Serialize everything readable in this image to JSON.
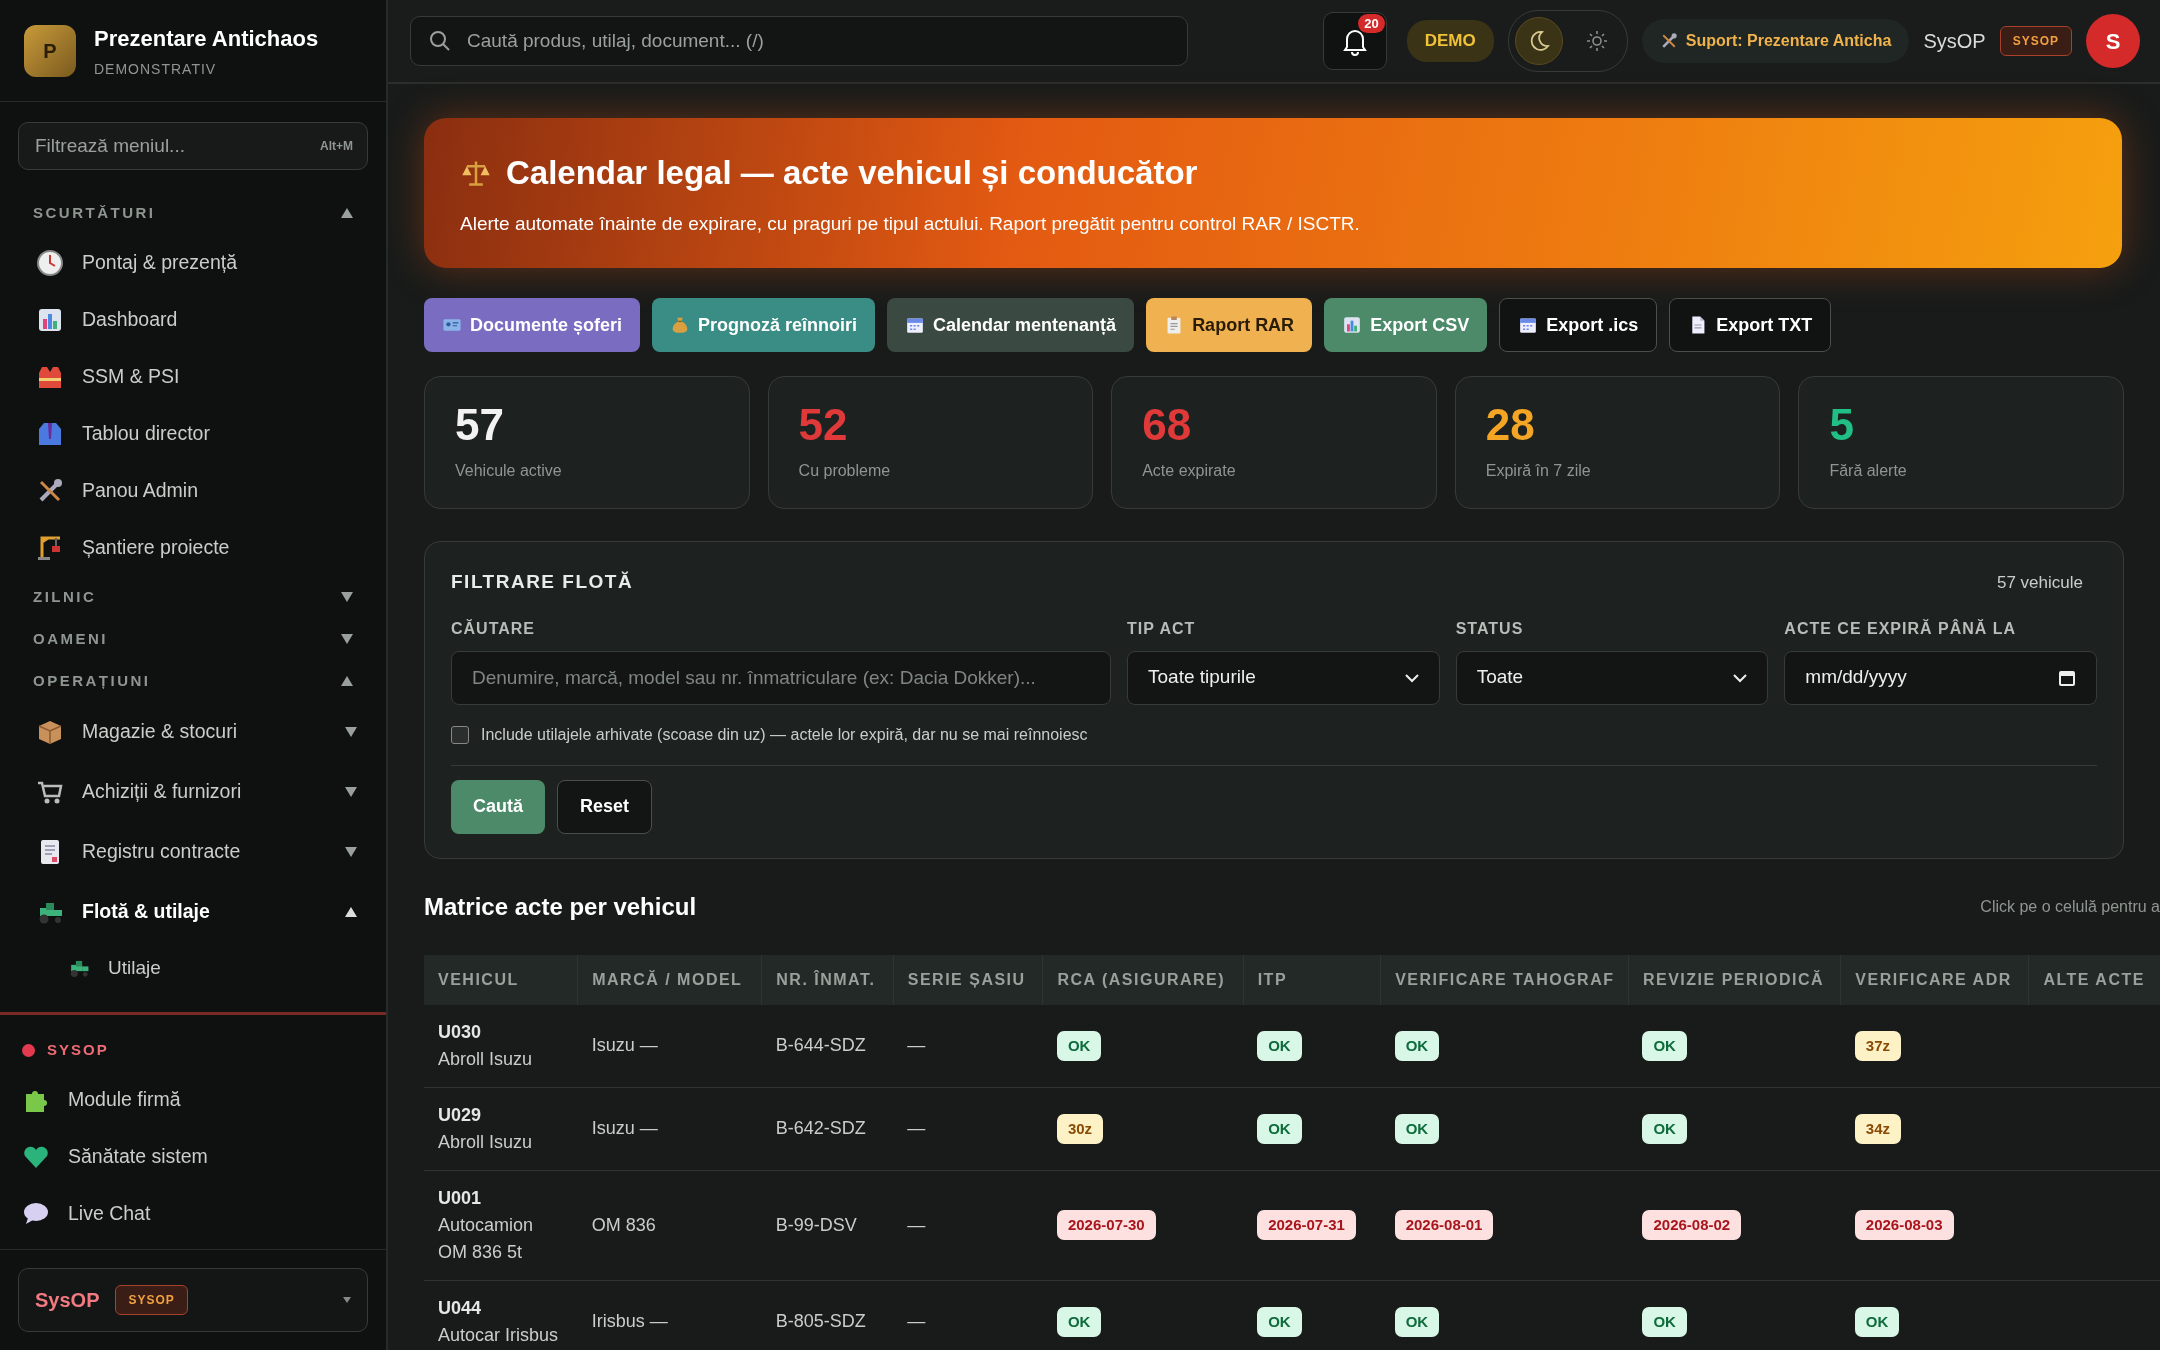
{
  "sidebar": {
    "brand": {
      "initial": "P",
      "title": "Prezentare Antichaos",
      "subtitle": "DEMONSTRATIV"
    },
    "filter": {
      "placeholder": "Filtrează meniul...",
      "shortcut": "Alt+M"
    },
    "sections": [
      {
        "label": "SCURTĂTURI",
        "expanded": true,
        "items": [
          {
            "label": "Pontaj & prezență",
            "selected": false
          },
          {
            "label": "Dashboard",
            "selected": false
          },
          {
            "label": "SSM & PSI",
            "selected": false
          },
          {
            "label": "Tablou director",
            "selected": false
          },
          {
            "label": "Panou Admin",
            "selected": false
          },
          {
            "label": "Șantiere proiecte",
            "selected": false
          }
        ]
      },
      {
        "label": "ZILNIC",
        "expanded": false
      },
      {
        "label": "OAMENI",
        "expanded": false
      },
      {
        "label": "OPERAȚIUNI",
        "expanded": true,
        "items": [
          {
            "label": "Magazie & stocuri",
            "selected": false,
            "expanded": false
          },
          {
            "label": "Achiziții & furnizori",
            "selected": false,
            "expanded": false
          },
          {
            "label": "Registru contracte",
            "selected": false,
            "expanded": false
          },
          {
            "label": "Flotă & utilaje",
            "selected": true,
            "expanded": true,
            "children": [
              {
                "label": "Utilaje",
                "selected": false
              }
            ]
          }
        ]
      }
    ],
    "admin": {
      "label": "SYSOP",
      "items": [
        {
          "label": "Module firmă",
          "selected": false
        },
        {
          "label": "Sănătate sistem",
          "selected": false
        },
        {
          "label": "Live Chat",
          "selected": false
        }
      ]
    },
    "user": {
      "name": "SysOP",
      "role": "SYSOP"
    }
  },
  "topbar": {
    "search": {
      "placeholder": "Caută produs, utilaj, document... (/)"
    },
    "notifications": "20",
    "demo": "DEMO",
    "theme": [
      {
        "kind": "dark",
        "selected": true
      },
      {
        "kind": "light",
        "selected": false
      }
    ],
    "support": "Suport: Prezentare Anticha",
    "user": "SysOP",
    "role": "SYSOP",
    "avatar": "S"
  },
  "banner": {
    "title": "Calendar legal — acte vehicul și conducător",
    "subtitle": "Alerte automate înainte de expirare, cu praguri pe tipul actului. Raport pregătit pentru control RAR / ISCTR."
  },
  "actions": [
    {
      "label": "Documente șoferi",
      "kind": "filled",
      "color": "#7a6cc0"
    },
    {
      "label": "Prognoză reînnoiri",
      "kind": "filled",
      "color": "#3a8d84"
    },
    {
      "label": "Calendar mentenanță",
      "kind": "filled",
      "color": "#3a4a42"
    },
    {
      "label": "Raport RAR",
      "kind": "filled",
      "color": "#f0b250"
    },
    {
      "label": "Export CSV",
      "kind": "filled",
      "color": "#4c8a6a"
    },
    {
      "label": "Export .ics",
      "kind": "outline"
    },
    {
      "label": "Export TXT",
      "kind": "outline"
    }
  ],
  "stats": [
    {
      "value": "57",
      "label": "Vehicule active",
      "color": "#f2f2f2"
    },
    {
      "value": "52",
      "label": "Cu probleme",
      "color": "#e0393a"
    },
    {
      "value": "68",
      "label": "Acte expirate",
      "color": "#e0393a"
    },
    {
      "value": "28",
      "label": "Expiră în 7 zile",
      "color": "#f5a524"
    },
    {
      "value": "5",
      "label": "Fără alerte",
      "color": "#1fbf85"
    }
  ],
  "filter": {
    "title": "FILTRARE FLOTĂ",
    "count": "57 vehicule",
    "search": {
      "label": "CĂUTARE",
      "placeholder": "Denumire, marcă, model sau nr. înmatriculare (ex: Dacia Dokker)..."
    },
    "type": {
      "label": "TIP ACT",
      "value": "Toate tipurile"
    },
    "status": {
      "label": "STATUS",
      "value": "Toate"
    },
    "date": {
      "label": "ACTE CE EXPIRĂ PÂNĂ LA",
      "value": "mm/dd/yyyy"
    },
    "archived": {
      "label": "Include utilajele arhivate (scoase din uz) — actele lor expiră, dar nu se mai reînnoiesc",
      "checked": false
    },
    "buttons": [
      "Caută",
      "Reset"
    ]
  },
  "matrix": {
    "title": "Matrice acte per vehicul",
    "hint": "Click pe o celulă pentru a",
    "columns": [
      "VEHICUL",
      "MARCĂ / MODEL",
      "NR. ÎNMAT.",
      "SERIE ȘASIU",
      "RCA (ASIGURARE)",
      "ITP",
      "VERIFICARE TAHOGRAF",
      "REVIZIE PERIODICĂ",
      "VERIFICARE ADR",
      "ALTE ACTE"
    ],
    "rows": [
      {
        "cells": [
          {
            "kind": "vehicle",
            "text": "U030",
            "subtext": "Abroll Isuzu"
          },
          {
            "kind": "text",
            "text": "Isuzu —"
          },
          {
            "kind": "text",
            "text": "B-644-SDZ"
          },
          {
            "kind": "text",
            "text": "—"
          },
          {
            "kind": "ok",
            "text": "OK"
          },
          {
            "kind": "ok",
            "text": "OK"
          },
          {
            "kind": "ok",
            "text": "OK"
          },
          {
            "kind": "ok",
            "text": "OK"
          },
          {
            "kind": "warn",
            "text": "37z"
          }
        ]
      },
      {
        "cells": [
          {
            "kind": "vehicle",
            "text": "U029",
            "subtext": "Abroll Isuzu"
          },
          {
            "kind": "text",
            "text": "Isuzu —"
          },
          {
            "kind": "text",
            "text": "B-642-SDZ"
          },
          {
            "kind": "text",
            "text": "—"
          },
          {
            "kind": "warn",
            "text": "30z"
          },
          {
            "kind": "ok",
            "text": "OK"
          },
          {
            "kind": "ok",
            "text": "OK"
          },
          {
            "kind": "ok",
            "text": "OK"
          },
          {
            "kind": "warn",
            "text": "34z"
          }
        ]
      },
      {
        "cells": [
          {
            "kind": "vehicle",
            "text": "U001",
            "subtext": "Autocamion OM 836 5t"
          },
          {
            "kind": "text",
            "text": "OM 836"
          },
          {
            "kind": "text",
            "text": "B-99-DSV"
          },
          {
            "kind": "text",
            "text": "—"
          },
          {
            "kind": "expired",
            "text": "2026-07-30"
          },
          {
            "kind": "expired",
            "text": "2026-07-31"
          },
          {
            "kind": "expired",
            "text": "2026-08-01"
          },
          {
            "kind": "expired",
            "text": "2026-08-02"
          },
          {
            "kind": "expired",
            "text": "2026-08-03"
          }
        ]
      },
      {
        "cells": [
          {
            "kind": "vehicle",
            "text": "U044",
            "subtext": "Autocar Irisbus"
          },
          {
            "kind": "text",
            "text": "Irisbus —"
          },
          {
            "kind": "text",
            "text": "B-805-SDZ"
          },
          {
            "kind": "text",
            "text": "—"
          },
          {
            "kind": "ok",
            "text": "OK"
          },
          {
            "kind": "ok",
            "text": "OK"
          },
          {
            "kind": "ok",
            "text": "OK"
          },
          {
            "kind": "ok",
            "text": "OK"
          },
          {
            "kind": "ok",
            "text": "OK"
          }
        ]
      }
    ]
  }
}
